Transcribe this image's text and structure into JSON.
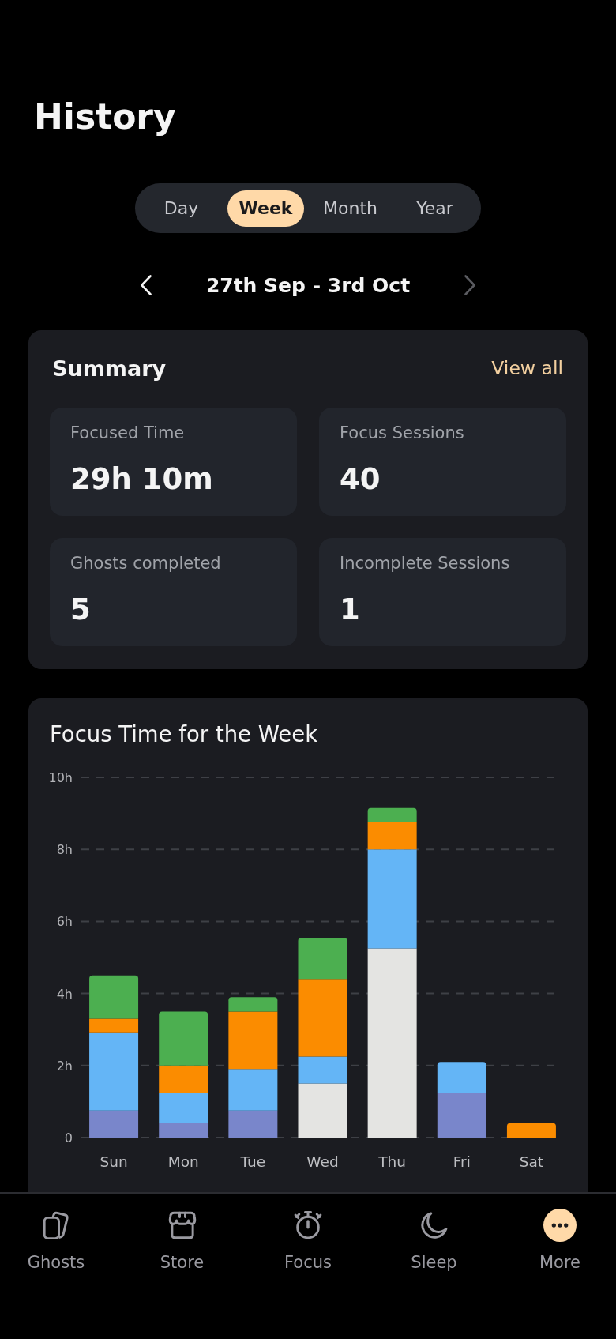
{
  "page": {
    "title": "History"
  },
  "period_tabs": [
    {
      "label": "Day",
      "selected": false
    },
    {
      "label": "Week",
      "selected": true
    },
    {
      "label": "Month",
      "selected": false
    },
    {
      "label": "Year",
      "selected": false
    }
  ],
  "date_nav": {
    "label": "27th Sep - 3rd Oct",
    "previous": {
      "disabled": false
    },
    "next": {
      "disabled": true
    }
  },
  "summary": {
    "title": "Summary",
    "link": "View all",
    "stats": [
      {
        "label": "Focused Time",
        "value": "29h 10m"
      },
      {
        "label": "Focus Sessions",
        "value": "40"
      },
      {
        "label": "Ghosts completed",
        "value": "5"
      },
      {
        "label": "Incomplete Sessions",
        "value": "1"
      }
    ]
  },
  "focus_chart": {
    "chart_data": {
      "type": "bar",
      "title": "Focus Time for the Week",
      "categories": [
        "Sun",
        "Mon",
        "Tue",
        "Wed",
        "Thu",
        "Fri",
        "Sat"
      ],
      "stacked": true,
      "grid": true,
      "ylim": [
        0,
        10
      ],
      "yticks": [
        {
          "value": 0,
          "label": "0"
        },
        {
          "value": 2,
          "label": "2h"
        },
        {
          "value": 4,
          "label": "4h"
        },
        {
          "value": 6,
          "label": "6h"
        },
        {
          "value": 8,
          "label": "8h"
        },
        {
          "value": 10,
          "label": "10h"
        }
      ],
      "series": [
        {
          "color": "#7986cb",
          "values": [
            0.75,
            0.4,
            0.75,
            0,
            0,
            1.25,
            0
          ]
        },
        {
          "color": "#e4e4e2",
          "values": [
            0,
            0,
            0,
            1.5,
            5.25,
            0,
            0
          ]
        },
        {
          "color": "#64b5f6",
          "values": [
            2.15,
            0.85,
            1.15,
            0.75,
            2.75,
            0.85,
            0
          ]
        },
        {
          "color": "#fb8c00",
          "values": [
            0.4,
            0.75,
            1.6,
            2.15,
            0.75,
            0,
            0.4
          ]
        },
        {
          "color": "#4caf50",
          "values": [
            1.2,
            1.5,
            0.4,
            1.15,
            0.4,
            0,
            0
          ]
        }
      ]
    }
  },
  "nav": [
    {
      "label": "Ghosts",
      "selected": false
    },
    {
      "label": "Store",
      "selected": false
    },
    {
      "label": "Focus",
      "selected": false
    },
    {
      "label": "Sleep",
      "selected": false
    },
    {
      "label": "More",
      "selected": true
    }
  ]
}
